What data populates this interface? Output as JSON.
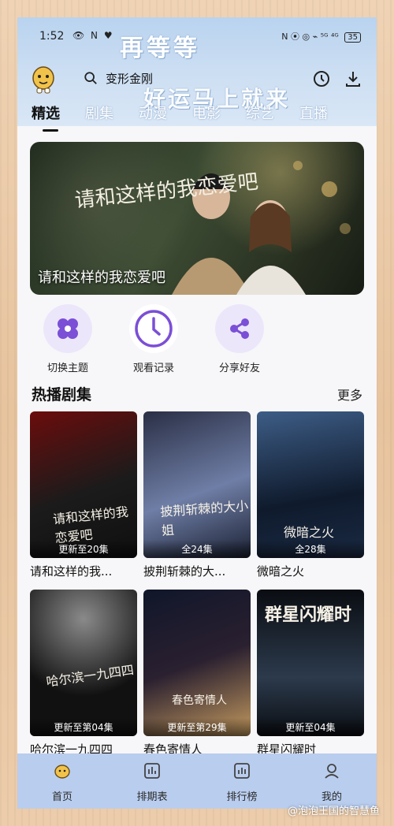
{
  "status_bar": {
    "time": "1:52",
    "icons_left": "👁 N ♥",
    "icons_right": "N ⦿ ◎ ⌁ ⁵ᴳ ⁴ᴳ",
    "battery": "35"
  },
  "header": {
    "banner_top": "再等等",
    "banner_bottom": "好运马上就来",
    "search_text": "变形金刚",
    "tabs": [
      {
        "label": "精选",
        "active": true
      },
      {
        "label": "剧集",
        "active": false
      },
      {
        "label": "动漫",
        "active": false
      },
      {
        "label": "电影",
        "active": false
      },
      {
        "label": "综艺",
        "active": false
      },
      {
        "label": "直播",
        "active": false
      }
    ]
  },
  "hero": {
    "title": "请和这样的我恋爱吧",
    "calligraphy": "请和这样的我恋爱吧"
  },
  "actions": [
    {
      "label": "切换主题",
      "icon": "theme-icon"
    },
    {
      "label": "观看记录",
      "icon": "clock-icon"
    },
    {
      "label": "分享好友",
      "icon": "share-icon"
    }
  ],
  "section": {
    "title": "热播剧集",
    "more": "更多"
  },
  "shows": [
    {
      "title": "请和这样的我...",
      "badge": "更新至20集",
      "colors": [
        "#1b1b1b",
        "#7a1010"
      ],
      "calli": "请和这样的我恋爱吧"
    },
    {
      "title": "披荆斩棘的大...",
      "badge": "全24集",
      "colors": [
        "#2a2f45",
        "#6f7ea6"
      ],
      "calli": "披荆斩棘的大小姐"
    },
    {
      "title": "微暗之火",
      "badge": "全28集",
      "colors": [
        "#0f1a2c",
        "#3d5d86"
      ],
      "calli": "微暗之火"
    },
    {
      "title": "哈尔滨一九四四",
      "badge": "更新至第04集",
      "colors": [
        "#111111",
        "#6b6b6b"
      ],
      "calli": "哈尔滨一九四四"
    },
    {
      "title": "春色寄情人",
      "badge": "更新至第29集",
      "colors": [
        "#10162a",
        "#c49a5f"
      ],
      "calli": "春色寄情人"
    },
    {
      "title": "群星闪耀时",
      "badge": "更新至04集",
      "colors": [
        "#0a0d12",
        "#2c3a4c"
      ],
      "calli": "群星闪耀时"
    }
  ],
  "bottom_nav": [
    {
      "label": "首页",
      "icon": "home-icon",
      "active": true
    },
    {
      "label": "排期表",
      "icon": "schedule-icon",
      "active": false
    },
    {
      "label": "排行榜",
      "icon": "ranking-icon",
      "active": false
    },
    {
      "label": "我的",
      "icon": "profile-icon",
      "active": false
    }
  ],
  "watermark": "@泡泡王国的智慧鱼",
  "colors": {
    "accent": "#7b4fd6",
    "accent_soft": "#ece6fb",
    "nav_bg": "#b9cdee"
  }
}
